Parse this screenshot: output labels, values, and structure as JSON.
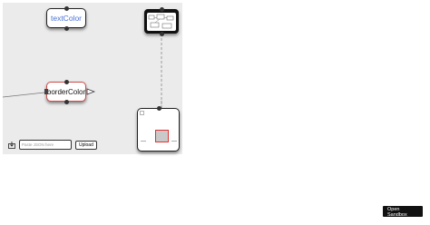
{
  "canvas": {
    "nodes": {
      "text_color": {
        "label": "textColor"
      },
      "border_color": {
        "label": "borderColor"
      }
    },
    "toolbar": {
      "json_placeholder": "Paste JSON here",
      "upload_label": "Upload"
    }
  },
  "footer": {
    "open_sandbox_label": "Open Sandbox"
  },
  "colors": {
    "canvas_bg": "#ebebeb",
    "text_color_label": "#4a72d6",
    "border_color_outline": "#d14a4a"
  }
}
